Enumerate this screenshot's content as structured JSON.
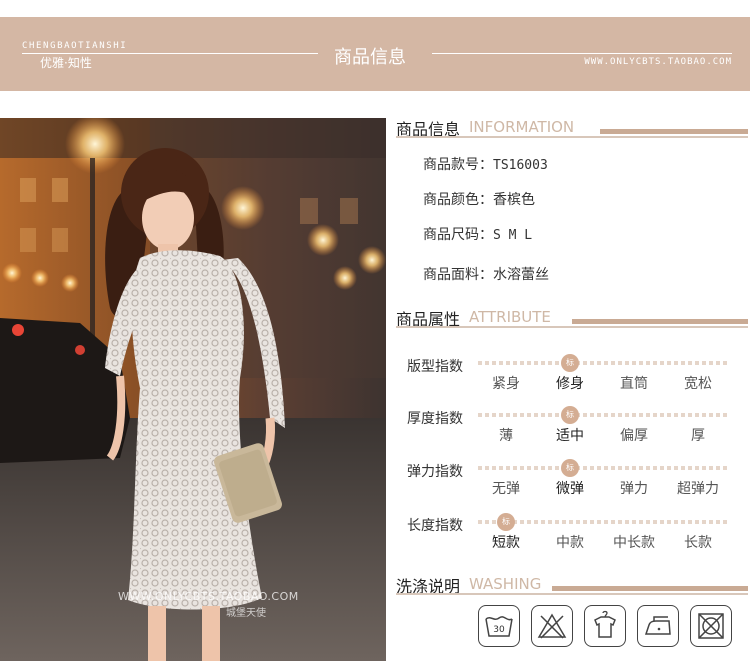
{
  "banner": {
    "brand_en": "CHENGBAOTIANSHI",
    "brand_cn": "优雅·知性",
    "title": "商品信息",
    "url": "WWW.ONLYCBTS.TAOBAO.COM"
  },
  "photo": {
    "watermark_url": "WWW.ONLYCBTS.TAOBAO.COM",
    "watermark_cn": "城堡天使"
  },
  "info": {
    "heading_cn": "商品信息",
    "heading_en": "INFORMATION",
    "rows": [
      {
        "label": "商品款号：",
        "value": "TS16003"
      },
      {
        "label": "商品颜色：",
        "value": "香槟色"
      },
      {
        "label": "商品尺码：",
        "value": "S M L"
      },
      {
        "label": "商品面料：",
        "value": "水溶蕾丝"
      }
    ]
  },
  "attributes": {
    "heading_cn": "商品属性",
    "heading_en": "ATTRIBUTE",
    "marker_text": "标",
    "rows": [
      {
        "label": "版型指数",
        "options": [
          "紧身",
          "修身",
          "直筒",
          "宽松"
        ],
        "selected": 1
      },
      {
        "label": "厚度指数",
        "options": [
          "薄",
          "适中",
          "偏厚",
          "厚"
        ],
        "selected": 1
      },
      {
        "label": "弹力指数",
        "options": [
          "无弹",
          "微弹",
          "弹力",
          "超弹力"
        ],
        "selected": 1
      },
      {
        "label": "长度指数",
        "options": [
          "短款",
          "中款",
          "中长款",
          "长款"
        ],
        "selected": 0
      }
    ]
  },
  "washing": {
    "heading_cn": "洗涤说明",
    "heading_en": "WASHING",
    "icons": [
      {
        "name": "wash-30-icon",
        "text": "30"
      },
      {
        "name": "no-bleach-icon",
        "text": ""
      },
      {
        "name": "hang-dry-icon",
        "text": ""
      },
      {
        "name": "iron-low-icon",
        "text": ""
      },
      {
        "name": "no-tumble-dry-icon",
        "text": ""
      }
    ]
  }
}
